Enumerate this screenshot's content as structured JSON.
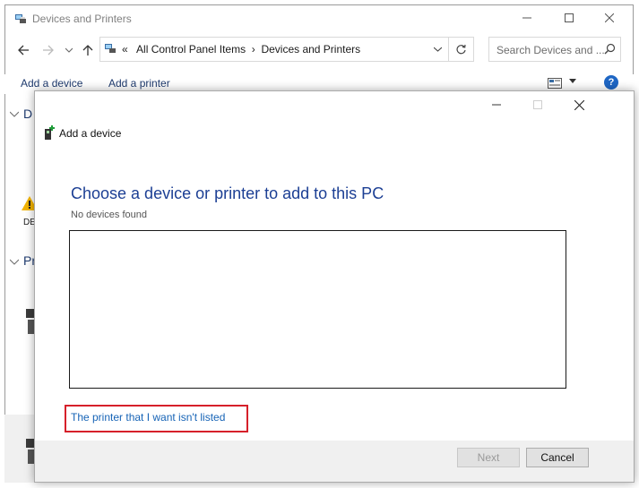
{
  "window": {
    "title": "Devices and Printers",
    "controls": {
      "minimize": "—",
      "maximize": "☐",
      "close": "✕"
    }
  },
  "address_bar": {
    "prefix": "«",
    "breadcrumb": [
      "All Control Panel Items",
      "Devices and Printers"
    ],
    "separator": "›"
  },
  "search": {
    "placeholder": "Search Devices and ..."
  },
  "commands": {
    "add_device": "Add a device",
    "add_printer": "Add a printer"
  },
  "background": {
    "section1_abbrev": "D",
    "section2_abbrev": "Pr",
    "device_label_abbrev": "DE"
  },
  "dialog": {
    "title": "Add a device",
    "heading": "Choose a device or printer to add to this PC",
    "status": "No devices found",
    "link": "The printer that I want isn't listed",
    "next_label": "Next",
    "cancel_label": "Cancel"
  },
  "colors": {
    "heading": "#1c3f94",
    "link": "#1663b6",
    "highlight": "#d6202a",
    "help": "#1e66c4"
  }
}
